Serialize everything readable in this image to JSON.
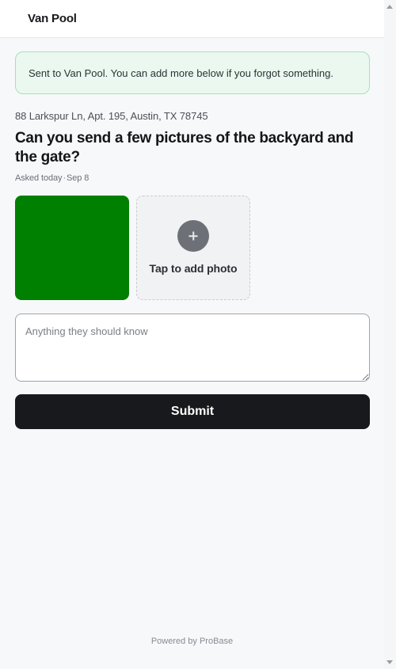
{
  "header": {
    "brand": "Van Pool"
  },
  "banner": {
    "message": "Sent to Van Pool. You can add more below if you forgot something."
  },
  "request": {
    "address": "88 Larkspur Ln, Apt. 195, Austin, TX 78745",
    "question": "Can you send a few pictures of the backyard and the gate?",
    "asked_prefix": "Asked today",
    "asked_separator": "·",
    "asked_date": "Sep 8"
  },
  "photos": {
    "thumbnail_color": "#008000",
    "add_label": "Tap to add photo",
    "add_icon": "plus-icon"
  },
  "notes": {
    "placeholder": "Anything they should know",
    "value": ""
  },
  "actions": {
    "submit_label": "Submit"
  },
  "footer": {
    "powered_by": "Powered by ProBase"
  },
  "colors": {
    "banner_bg": "#eaf8ef",
    "banner_border": "#a9dfbe",
    "submit_bg": "#18191c",
    "photo_green": "#008000"
  }
}
